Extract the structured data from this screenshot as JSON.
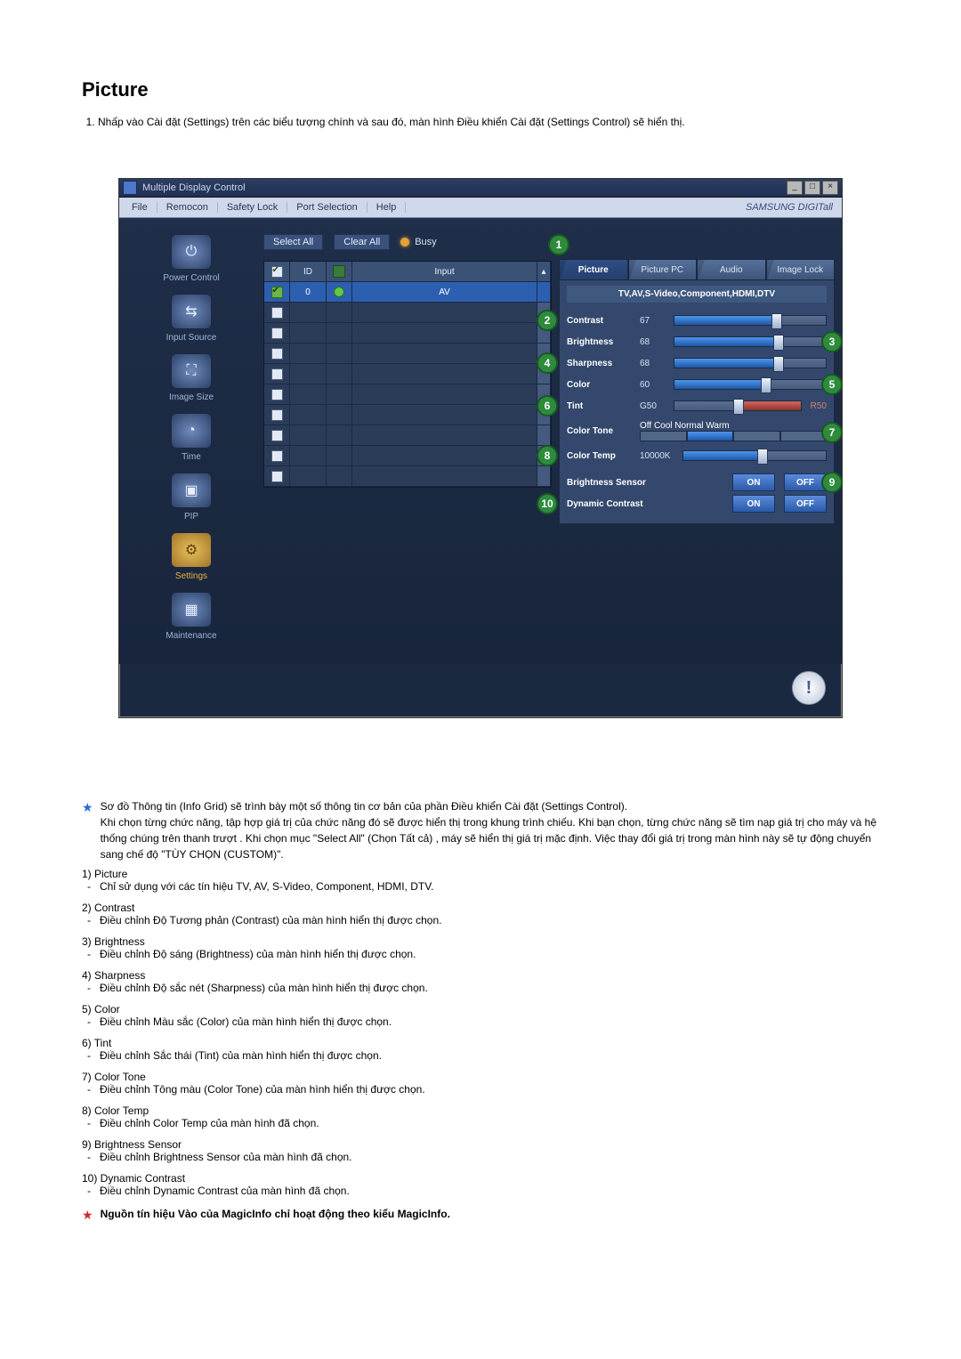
{
  "title": "Picture",
  "intro_item": "Nhấp vào Cài đặt (Settings) trên các biểu tượng chính và sau đó, màn hình Điều khiển Cài đặt (Settings Control) sẽ hiển thị.",
  "app": {
    "window_title": "Multiple Display Control",
    "menu": [
      "File",
      "Remocon",
      "Safety Lock",
      "Port Selection",
      "Help"
    ],
    "brand": "SAMSUNG DIGITall",
    "win_btns": [
      "_",
      "□",
      "×"
    ],
    "toolbar": {
      "select_all": "Select All",
      "clear_all": "Clear All",
      "busy": "Busy"
    },
    "sidebar": [
      {
        "glyph": "⏻",
        "label": "Power Control",
        "warn": false
      },
      {
        "glyph": "⇆",
        "label": "Input Source",
        "warn": false
      },
      {
        "glyph": "⛶",
        "label": "Image Size",
        "warn": false
      },
      {
        "glyph": "◔",
        "label": "Time",
        "warn": false
      },
      {
        "glyph": "▣",
        "label": "PIP",
        "warn": false
      },
      {
        "glyph": "⚙",
        "label": "Settings",
        "warn": true
      },
      {
        "glyph": "▦",
        "label": "Maintenance",
        "warn": false
      }
    ],
    "grid": {
      "hdr_id": "ID",
      "hdr_input": "Input",
      "row0_id": "0",
      "row0_input": "AV"
    },
    "tabs": [
      "Picture",
      "Picture PC",
      "Audio",
      "Image Lock"
    ],
    "panel_header": "TV,AV,S-Video,Component,HDMI,DTV",
    "sliders": {
      "contrast": {
        "label": "Contrast",
        "value": "67"
      },
      "brightness": {
        "label": "Brightness",
        "value": "68"
      },
      "sharpness": {
        "label": "Sharpness",
        "value": "68"
      },
      "color": {
        "label": "Color",
        "value": "60"
      },
      "tint": {
        "label": "Tint",
        "left": "G50",
        "right": "R50"
      }
    },
    "color_tone": {
      "label": "Color Tone",
      "opts": [
        "Off",
        "Cool",
        "Normal",
        "Warm"
      ]
    },
    "color_temp": {
      "label": "Color Temp",
      "value": "10000K"
    },
    "bsensor": {
      "label": "Brightness Sensor",
      "on": "ON",
      "off": "OFF"
    },
    "dcontrast": {
      "label": "Dynamic Contrast",
      "on": "ON",
      "off": "OFF"
    },
    "badges": {
      "b1": "1",
      "b2": "2",
      "b3": "3",
      "b4": "4",
      "b5": "5",
      "b6": "6",
      "b7": "7",
      "b8": "8",
      "b9": "9",
      "b10": "10"
    }
  },
  "info_note": "Sơ đồ Thông tin (Info Grid) sẽ trình bày một số thông tin cơ bản của phần Điều khiển Cài đặt (Settings Control).\nKhi chọn từng chức năng, tập hợp giá trị của chức năng đó sẽ được hiển thị trong khung trình chiếu. Khi bạn chọn, từng chức năng sẽ tìm nạp giá trị cho máy và hệ thống chúng trên thanh trượt . Khi chọn mục \"Select All\" (Chọn Tất cả) , máy sẽ hiển thị giá trị mặc định. Việc thay đổi giá trị trong màn hình này sẽ tự động chuyển sang chế độ \"TÙY CHỌN (CUSTOM)\".",
  "items": [
    {
      "h": "Picture",
      "d": "Chỉ sử dụng với các tín hiệu TV, AV, S-Video, Component, HDMI, DTV."
    },
    {
      "h": "Contrast",
      "d": "Điều chỉnh Độ Tương phản (Contrast) của màn hình hiển thị được chọn."
    },
    {
      "h": "Brightness",
      "d": "Điều chỉnh Độ sáng (Brightness) của màn hình hiển thị được chọn."
    },
    {
      "h": "Sharpness",
      "d": "Điều chỉnh Độ sắc nét (Sharpness) của màn hình hiển thị được chọn."
    },
    {
      "h": "Color",
      "d": "Điều chỉnh Màu sắc (Color) của màn hình hiển thị được chọn."
    },
    {
      "h": "Tint",
      "d": "Điều chỉnh Sắc thái (Tint) của màn hình hiển thị được chọn."
    },
    {
      "h": "Color Tone",
      "d": "Điều chỉnh Tông màu (Color Tone) của màn hình hiển thị được chọn."
    },
    {
      "h": "Color Temp",
      "d": "Điều chỉnh Color Temp của màn hình đã chọn."
    },
    {
      "h": "Brightness Sensor",
      "d": "Điều chỉnh Brightness Sensor của màn hình đã chọn."
    },
    {
      "h": "Dynamic Contrast",
      "d": "Điều chỉnh Dynamic Contrast của màn hình đã chọn."
    }
  ],
  "footer_note": "Nguồn tín hiệu Vào của MagicInfo chỉ hoạt động theo kiểu MagicInfo."
}
